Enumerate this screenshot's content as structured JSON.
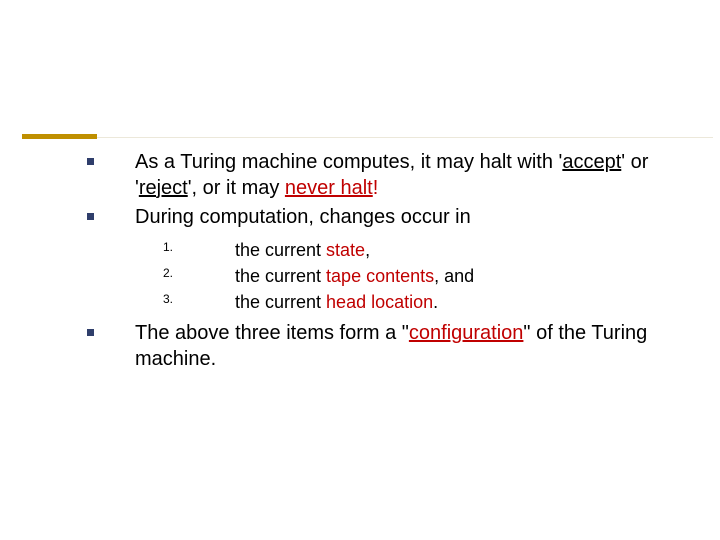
{
  "bullets": {
    "b1_pre": "As a Turing machine computes, it may halt with '",
    "b1_accept": "accept",
    "b1_mid": "' or '",
    "b1_reject": "reject",
    "b1_mid2": "', or it may ",
    "b1_never": "never halt",
    "b1_end": "!",
    "b2": "During computation, changes occur in",
    "b3_pre": "The above three items form a \"",
    "b3_config": "configuration",
    "b3_post": "\" of the Turing machine."
  },
  "numbered": {
    "n1_num": "1.",
    "n1_pre": "the current ",
    "n1_key": "state",
    "n1_post": ",",
    "n2_num": "2.",
    "n2_pre": "the current ",
    "n2_key": "tape contents",
    "n2_post": ", and",
    "n3_num": "3.",
    "n3_pre": "the current ",
    "n3_key": "head location",
    "n3_post": "."
  }
}
